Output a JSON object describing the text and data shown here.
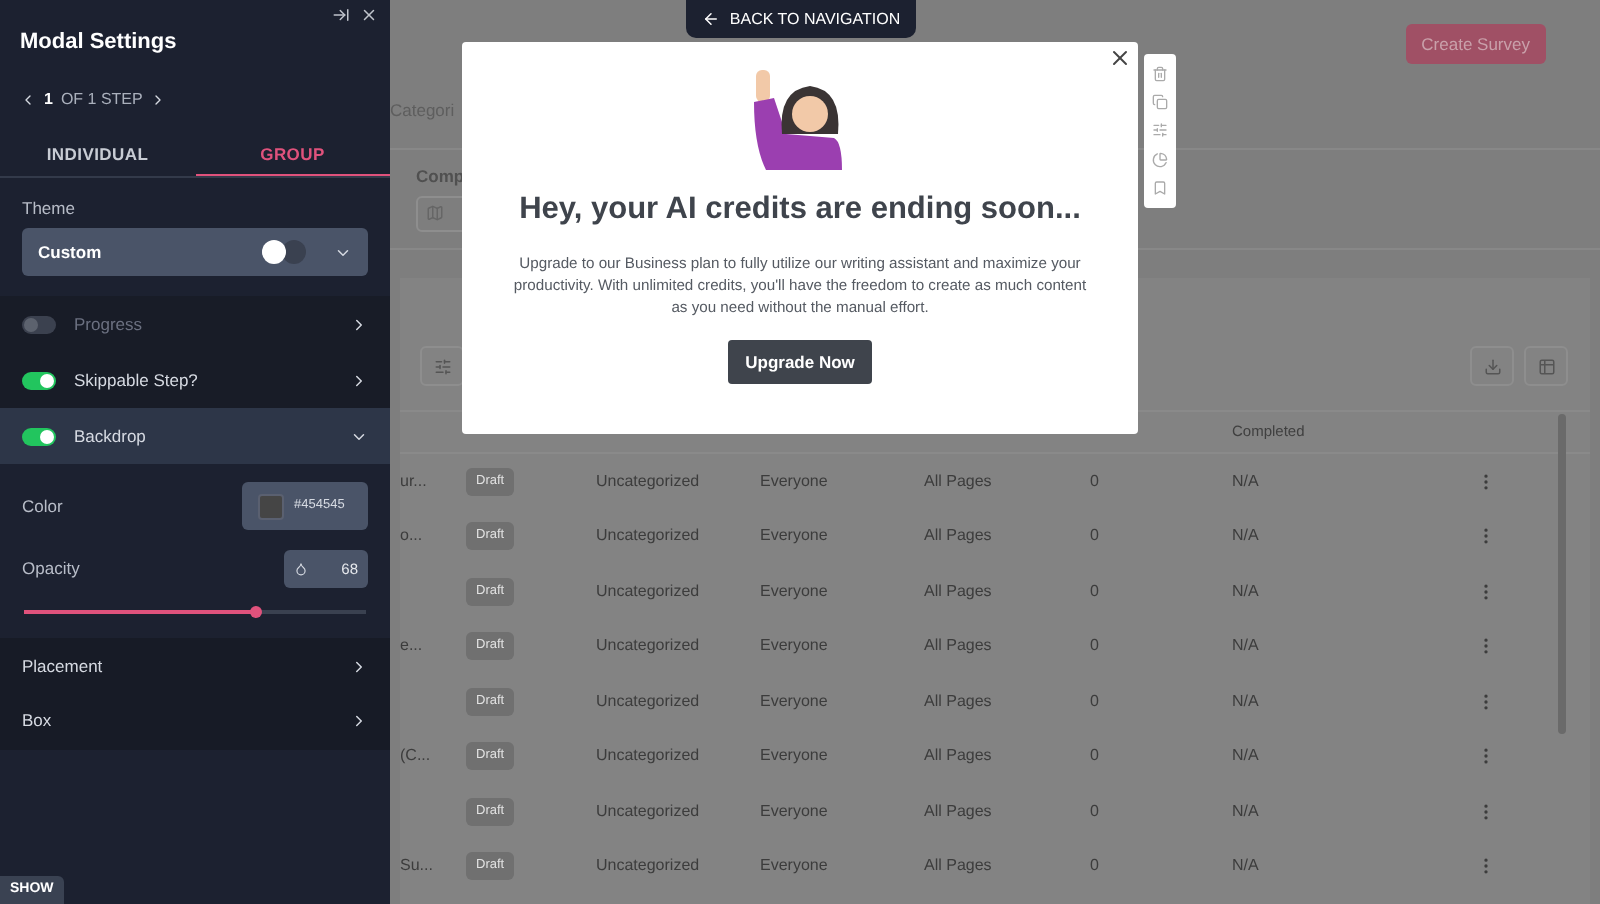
{
  "panel": {
    "title": "Modal Settings",
    "step": {
      "current": "1",
      "label": "OF 1 STEP"
    },
    "tabs": [
      {
        "label": "INDIVIDUAL",
        "selected": false
      },
      {
        "label": "GROUP",
        "selected": true
      }
    ],
    "theme": {
      "label": "Theme",
      "value": "Custom"
    },
    "rows": [
      {
        "kind": "toggle",
        "label": "Progress",
        "on": false,
        "disabled": true,
        "expanded": false
      },
      {
        "kind": "toggle",
        "label": "Skippable Step?",
        "on": true,
        "disabled": false,
        "expanded": false
      },
      {
        "kind": "toggle",
        "label": "Backdrop",
        "on": true,
        "disabled": false,
        "expanded": true
      }
    ],
    "backdrop": {
      "color_label": "Color",
      "color_value": "#454545",
      "opacity_label": "Opacity",
      "opacity_value": "68",
      "level": 0.68
    },
    "more_rows": [
      {
        "label": "Placement"
      },
      {
        "label": "Box"
      }
    ],
    "show_button": "SHOW"
  },
  "page": {
    "create_button": "Create Survey",
    "tab_fragment": "Categori",
    "filter_label": "Comp",
    "columns": [
      "Completed"
    ],
    "rows": [
      {
        "name": "ur...",
        "status": "Draft",
        "category": "Uncategorized",
        "audience": "Everyone",
        "pages": "All Pages",
        "count": "0",
        "completed": "N/A"
      },
      {
        "name": "o...",
        "status": "Draft",
        "category": "Uncategorized",
        "audience": "Everyone",
        "pages": "All Pages",
        "count": "0",
        "completed": "N/A"
      },
      {
        "name": "",
        "status": "Draft",
        "category": "Uncategorized",
        "audience": "Everyone",
        "pages": "All Pages",
        "count": "0",
        "completed": "N/A"
      },
      {
        "name": "e...",
        "status": "Draft",
        "category": "Uncategorized",
        "audience": "Everyone",
        "pages": "All Pages",
        "count": "0",
        "completed": "N/A"
      },
      {
        "name": "",
        "status": "Draft",
        "category": "Uncategorized",
        "audience": "Everyone",
        "pages": "All Pages",
        "count": "0",
        "completed": "N/A"
      },
      {
        "name": "(C...",
        "status": "Draft",
        "category": "Uncategorized",
        "audience": "Everyone",
        "pages": "All Pages",
        "count": "0",
        "completed": "N/A"
      },
      {
        "name": "",
        "status": "Draft",
        "category": "Uncategorized",
        "audience": "Everyone",
        "pages": "All Pages",
        "count": "0",
        "completed": "N/A"
      },
      {
        "name": "Su...",
        "status": "Draft",
        "category": "Uncategorized",
        "audience": "Everyone",
        "pages": "All Pages",
        "count": "0",
        "completed": "N/A"
      }
    ]
  },
  "back_button": "BACK TO NAVIGATION",
  "modal": {
    "title": "Hey, your AI credits are ending soon...",
    "body": "Upgrade to our Business plan to fully utilize our writing assistant and maximize your productivity. With unlimited credits, you'll have the freedom to create as much content as you need without the manual effort.",
    "button": "Upgrade Now"
  }
}
